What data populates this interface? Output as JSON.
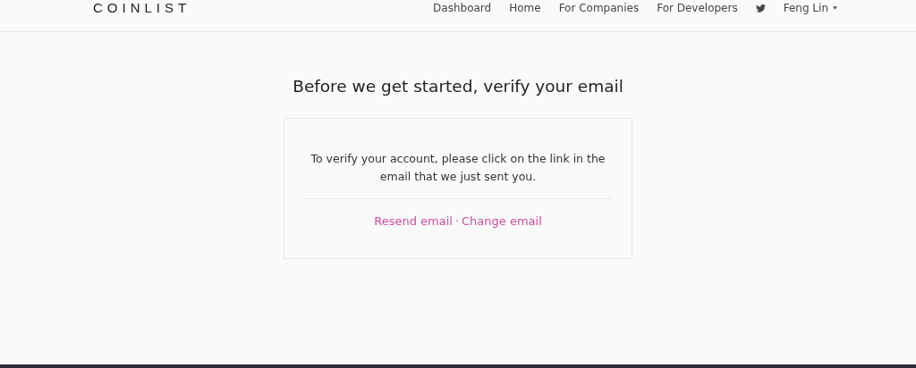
{
  "header": {
    "logo": "COINLIST",
    "nav": [
      {
        "kind": "link",
        "label": "Dashboard"
      },
      {
        "kind": "link",
        "label": "Home"
      },
      {
        "kind": "link",
        "label": "For Companies"
      },
      {
        "kind": "link",
        "label": "For Developers"
      },
      {
        "kind": "twitter"
      },
      {
        "kind": "user",
        "label": "Feng Lin"
      }
    ]
  },
  "title": "Before we get started, verify your email",
  "card": {
    "message": "To verify your account, please click on the link in the email that we just sent you.",
    "links": [
      "Resend email",
      "Change email"
    ],
    "separator": "·"
  }
}
